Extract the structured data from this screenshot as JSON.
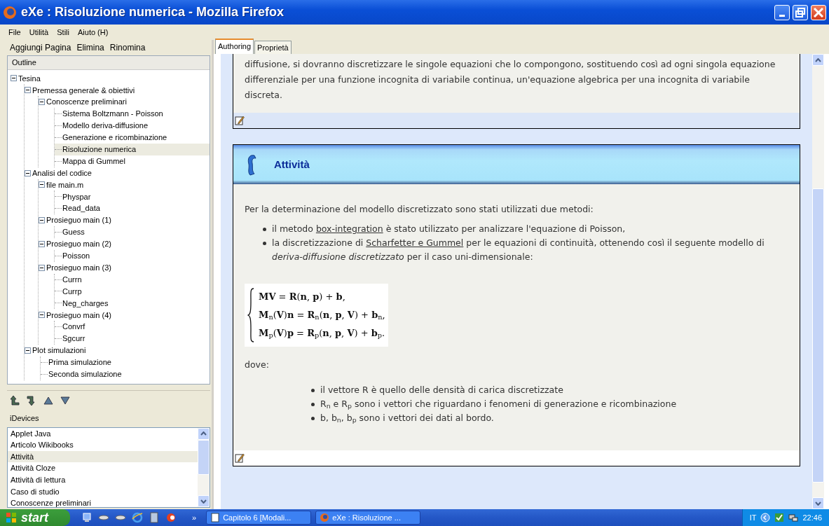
{
  "window": {
    "title": "eXe : Risoluzione numerica - Mozilla Firefox"
  },
  "menu": [
    "File",
    "Utilità",
    "Stili",
    "Aiuto (H)"
  ],
  "outline_toolbar": [
    "Aggiungi Pagina",
    "Elimina",
    "Rinomina"
  ],
  "outline": {
    "title": "Outline",
    "tree": [
      {
        "label": "Tesina",
        "expanded": true,
        "selected": false,
        "children": [
          {
            "label": "Premessa generale & obiettivi",
            "expanded": true,
            "selected": false,
            "children": [
              {
                "label": "Conoscenze preliminari",
                "expanded": true,
                "selected": false,
                "children": [
                  {
                    "label": "Sistema Boltzmann -  Poisson",
                    "selected": false
                  },
                  {
                    "label": "Modello deriva-diffusione",
                    "selected": false
                  },
                  {
                    "label": "Generazione e ricombinazione",
                    "selected": false
                  },
                  {
                    "label": "Risoluzione numerica",
                    "selected": true
                  },
                  {
                    "label": "Mappa di Gummel",
                    "selected": false
                  }
                ]
              }
            ]
          },
          {
            "label": "Analisi del codice",
            "expanded": true,
            "selected": false,
            "children": [
              {
                "label": "file main.m",
                "expanded": true,
                "selected": false,
                "children": [
                  {
                    "label": "Physpar",
                    "selected": false
                  },
                  {
                    "label": "Read_data",
                    "selected": false
                  }
                ]
              },
              {
                "label": "Prosieguo main (1)",
                "expanded": true,
                "selected": false,
                "children": [
                  {
                    "label": "Guess",
                    "selected": false
                  }
                ]
              },
              {
                "label": "Prosieguo main (2)",
                "expanded": true,
                "selected": false,
                "children": [
                  {
                    "label": "Poisson",
                    "selected": false
                  }
                ]
              },
              {
                "label": "Prosieguo main (3)",
                "expanded": true,
                "selected": false,
                "children": [
                  {
                    "label": "Currn",
                    "selected": false
                  },
                  {
                    "label": "Currp",
                    "selected": false
                  },
                  {
                    "label": "Neg_charges",
                    "selected": false
                  }
                ]
              },
              {
                "label": "Prosieguo main (4)",
                "expanded": true,
                "selected": false,
                "children": [
                  {
                    "label": "Convrf",
                    "selected": false
                  },
                  {
                    "label": "Sgcurr",
                    "selected": false
                  }
                ]
              }
            ]
          },
          {
            "label": "Plot simulazioni",
            "expanded": true,
            "selected": false,
            "children": [
              {
                "label": "Prima simulazione",
                "selected": false
              },
              {
                "label": "Seconda simulazione",
                "selected": false
              }
            ]
          }
        ]
      }
    ]
  },
  "idevices": {
    "title": "iDevices",
    "items": [
      {
        "label": "Applet Java",
        "selected": false
      },
      {
        "label": "Articolo Wikibooks",
        "selected": false
      },
      {
        "label": "Attività",
        "selected": true
      },
      {
        "label": "Attività Cloze",
        "selected": false
      },
      {
        "label": "Attività  di lettura",
        "selected": false
      },
      {
        "label": "Caso di studio",
        "selected": false
      },
      {
        "label": "Conoscenze preliminari",
        "selected": false
      }
    ]
  },
  "tabs": [
    {
      "label": "Authoring",
      "selected": true
    },
    {
      "label": "Proprietà",
      "selected": false
    }
  ],
  "previous_text": "diffusione, si dovranno discretizzare le singole equazioni che lo compongono, sostituendo così ad ogni singola equazione differenziale per una funzione incognita di variabile continua, un'equazione algebrica per una incognita di variabile discreta.",
  "activity": {
    "title": "Attività",
    "intro": "Per la determinazione del modello discretizzato sono stati utilizzati due metodi:",
    "methods": [
      {
        "before": "il metodo ",
        "link": "box-integration",
        "after": " è stato utilizzato per analizzare l'equazione di Poisson,"
      },
      {
        "before": "la discretizzazione di ",
        "link": "Scharfetter e Gummel",
        "after": " per le equazioni di continuità, ottenendo così il seguente modello di *deriva-diffusione discretizzato* per il caso uni-dimensionale:"
      }
    ],
    "equations": [
      "**MV** = **R**(**n**, **p**) + **b**,",
      "**M**$_{n}$(**V**)**n** = **R**$_{n}$(**n**, **p**, **V**) + **b**$_{n}$,",
      "**M**$_{p}$(**V**)**p** = **R**$_{p}$(**n**, **p**, **V**) + **b**$_{p}$."
    ],
    "where": "dove:",
    "notes": [
      "il vettore R è quello delle densità di carica discretizzate",
      "R$_{n}$ e R$_{p}$ sono i vettori che riguardano i fenomeni di generazione e ricombinazione",
      "b, b$_{n}$, b$_{p}$ sono i vettori dei dati al bordo."
    ]
  },
  "taskbar": {
    "start": "start",
    "overflow": "»",
    "tasks": [
      "Capitolo 6 [Modali...",
      "eXe : Risoluzione ..."
    ],
    "language": "IT",
    "clock": "22:46"
  }
}
